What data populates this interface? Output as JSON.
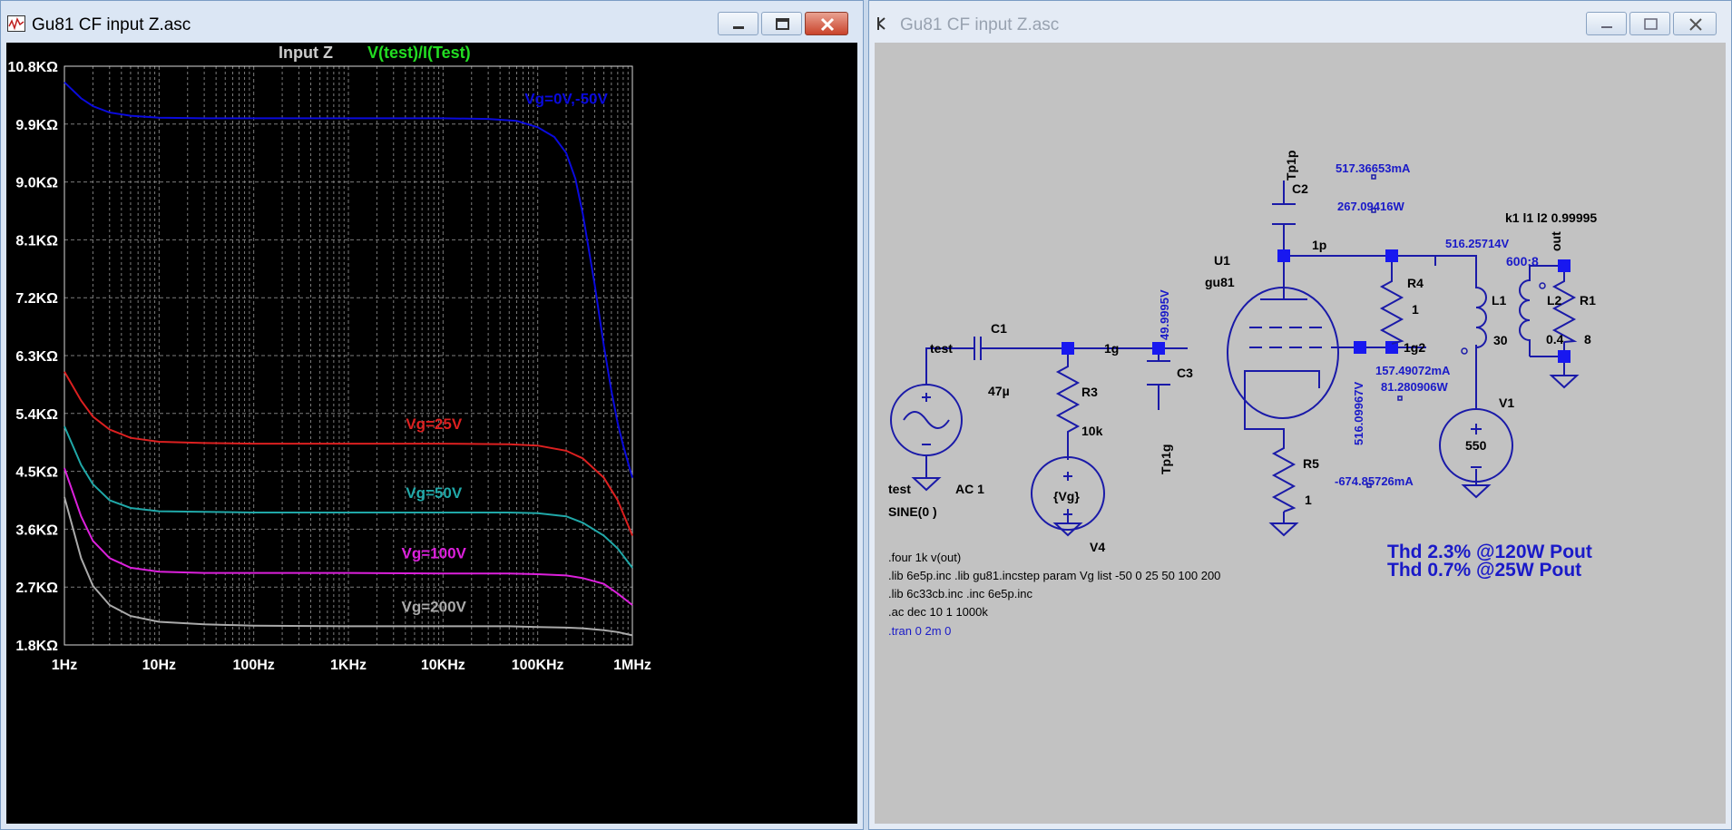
{
  "plot_window": {
    "title": "Gu81 CF input Z.asc",
    "icon": "waveform-plot-icon",
    "controls": [
      "minimize-icon",
      "maximize-icon",
      "close-icon"
    ]
  },
  "schematic_window": {
    "title": "Gu81 CF input Z.asc",
    "icon": "schematic-cursor-icon",
    "controls": [
      "minimize-icon",
      "maximize-icon",
      "close-icon"
    ]
  },
  "chart_data": {
    "type": "line",
    "trace_labels": [
      "Input Z",
      "V(test)/I(Test)"
    ],
    "x_scale": "log",
    "xlim": [
      1,
      1000000
    ],
    "x_ticks": [
      1,
      10,
      100,
      1000,
      10000,
      100000,
      1000000
    ],
    "x_tick_labels": [
      "1Hz",
      "10Hz",
      "100Hz",
      "1KHz",
      "10KHz",
      "100KHz",
      "1MHz"
    ],
    "ylim": [
      1.8,
      10.8
    ],
    "y_ticks": [
      1.8,
      2.7,
      3.6,
      4.5,
      5.4,
      6.3,
      7.2,
      8.1,
      9.0,
      9.9,
      10.8
    ],
    "y_tick_labels": [
      "1.8KΩ",
      "2.7KΩ",
      "3.6KΩ",
      "4.5KΩ",
      "5.4KΩ",
      "6.3KΩ",
      "7.2KΩ",
      "8.1KΩ",
      "9.0KΩ",
      "9.9KΩ",
      "10.8KΩ"
    ],
    "grid": true,
    "colors": {
      "background": "#000000",
      "grid": "#7c7c7c",
      "axis_text": "#ffffff",
      "trace_name": "#cccccc",
      "expr": "#22dd22"
    },
    "series": [
      {
        "name": "Vg=0V,-50V",
        "color": "#0a0adc",
        "x": [
          1,
          1.5,
          2,
          3,
          5,
          10,
          30,
          100,
          1000,
          10000,
          30000,
          60000,
          100000,
          150000,
          200000,
          250000,
          300000,
          400000,
          500000,
          600000,
          700000,
          800000,
          1000000
        ],
        "y": [
          10.55,
          10.3,
          10.18,
          10.08,
          10.03,
          10.0,
          9.99,
          9.99,
          9.99,
          9.99,
          9.98,
          9.95,
          9.85,
          9.7,
          9.45,
          9.05,
          8.5,
          7.4,
          6.45,
          5.75,
          5.25,
          4.9,
          4.4
        ]
      },
      {
        "name": "Vg=25V",
        "color": "#dc2020",
        "x": [
          1,
          1.5,
          2,
          3,
          5,
          10,
          30,
          100,
          1000,
          10000,
          50000,
          100000,
          200000,
          300000,
          500000,
          700000,
          1000000
        ],
        "y": [
          6.05,
          5.6,
          5.35,
          5.15,
          5.02,
          4.96,
          4.94,
          4.93,
          4.93,
          4.93,
          4.92,
          4.9,
          4.82,
          4.7,
          4.4,
          4.05,
          3.5
        ]
      },
      {
        "name": "Vg=50V",
        "color": "#20a8a8",
        "x": [
          1,
          1.5,
          2,
          3,
          5,
          10,
          30,
          100,
          1000,
          10000,
          50000,
          100000,
          200000,
          300000,
          500000,
          700000,
          1000000
        ],
        "y": [
          5.2,
          4.6,
          4.3,
          4.05,
          3.93,
          3.88,
          3.87,
          3.86,
          3.86,
          3.86,
          3.86,
          3.85,
          3.8,
          3.7,
          3.5,
          3.3,
          3.0
        ]
      },
      {
        "name": "Vg=100V",
        "color": "#dc20dc",
        "x": [
          1,
          1.5,
          2,
          3,
          5,
          10,
          30,
          100,
          1000,
          10000,
          50000,
          100000,
          200000,
          300000,
          500000,
          700000,
          1000000
        ],
        "y": [
          4.55,
          3.8,
          3.42,
          3.15,
          3.0,
          2.94,
          2.92,
          2.92,
          2.92,
          2.91,
          2.91,
          2.9,
          2.88,
          2.84,
          2.75,
          2.6,
          2.42
        ]
      },
      {
        "name": "Vg=200V",
        "color": "#aaaaaa",
        "x": [
          1,
          1.5,
          2,
          3,
          5,
          10,
          30,
          100,
          1000,
          10000,
          50000,
          100000,
          200000,
          300000,
          500000,
          700000,
          1000000
        ],
        "y": [
          4.1,
          3.15,
          2.72,
          2.42,
          2.25,
          2.16,
          2.12,
          2.1,
          2.09,
          2.09,
          2.09,
          2.08,
          2.07,
          2.06,
          2.03,
          2.0,
          1.95
        ]
      }
    ]
  },
  "schematic": {
    "net_labels": {
      "test_top": "test",
      "test_bottom": "test",
      "g1": "1g",
      "p1": "1p",
      "g2": "1g2",
      "out": "out",
      "tp1p": "Tp1p",
      "tp1g": "Tp1g"
    },
    "parts": {
      "C1": {
        "ref": "C1",
        "value": "47µ"
      },
      "C2": {
        "ref": "C2"
      },
      "C3": {
        "ref": "C3"
      },
      "R3": {
        "ref": "R3",
        "value": "10k"
      },
      "R4": {
        "ref": "R4",
        "value": "1"
      },
      "R5": {
        "ref": "R5",
        "value": "1"
      },
      "R1": {
        "ref": "R1",
        "value": "8"
      },
      "L1": {
        "ref": "L1",
        "value": "30"
      },
      "L2": {
        "ref": "L2",
        "value": "0.4"
      },
      "U1": {
        "ref": "U1",
        "value": "gu81"
      },
      "V1": {
        "ref": "V1",
        "value": "550"
      },
      "V4": {
        "ref": "V4",
        "value": "{Vg}"
      },
      "source": {
        "ac": "AC 1",
        "sine": "SINE(0     )"
      }
    },
    "op_annotations": {
      "i_plate": "517.36653mA",
      "p_plate": "267.09416W",
      "v_plate": "516.25714V",
      "v_grid1": "49.9995V",
      "v_screen": "516.09967V",
      "i_screen": "157.49072mA",
      "p_screen": "81.280906W",
      "i_cathode": "-674.85726mA"
    },
    "coupling": "k1 l1 l2 0.99995",
    "ratio": "600:8",
    "directives": [
      ".four 1k v(out)",
      ".lib 6e5p.inc     .lib gu81.incstep param Vg list -50 0 25 50 100 200",
      ".lib 6c33cb.inc .inc 6e5p.inc",
      ".ac dec 10 1 1000k"
    ],
    "disabled_directive": ".tran 0 2m 0",
    "notes": [
      "Thd 2.3% @120W Pout",
      "Thd 0.7% @25W Pout"
    ],
    "colors": {
      "wire": "#1a1aa8",
      "junction": "#1818f0",
      "text": "#000000",
      "annotation": "#1a1ac8",
      "background": "#c2c2c2"
    }
  }
}
